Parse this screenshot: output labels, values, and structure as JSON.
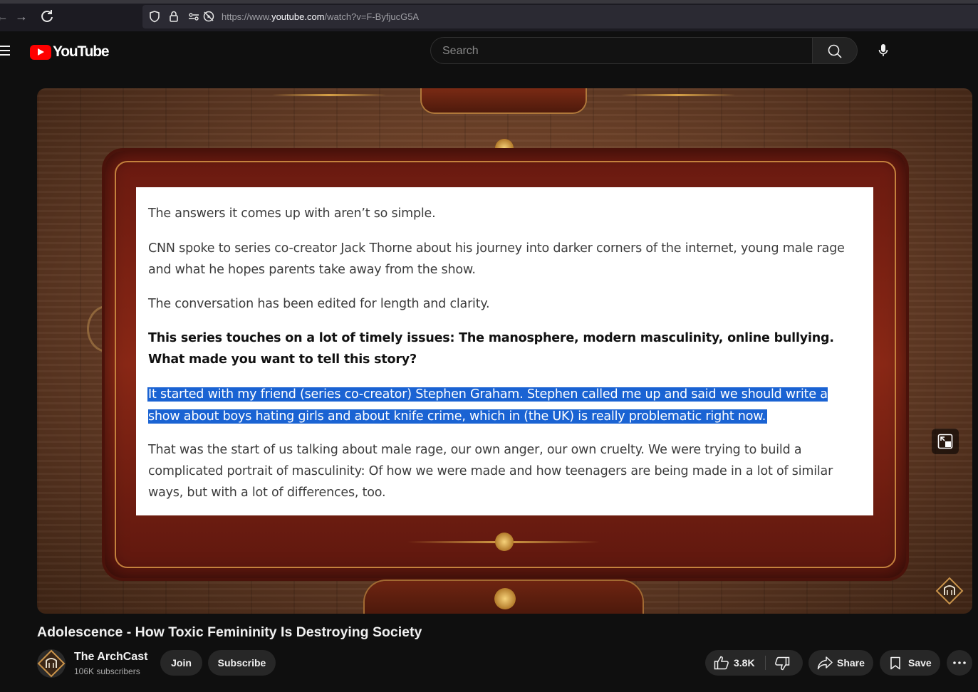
{
  "browser": {
    "url_prefix": "https://www.",
    "url_domain": "youtube.com",
    "url_path": "/watch?v=F-ByfjucG5A"
  },
  "header": {
    "logo_text": "YouTube",
    "search_placeholder": "Search"
  },
  "video": {
    "article_paragraphs": [
      "The answers it comes up with aren’t so simple.",
      "CNN spoke to series co-creator Jack Thorne about his journey into darker corners of the internet, young male rage and what he hopes parents take away from the show.",
      "The conversation has been edited for length and clarity.",
      "This series touches on a lot of timely issues: The manosphere, modern masculinity, online bullying. What made you want to tell this story?",
      "It started with my friend (series co-creator) Stephen Graham. Stephen called me up and said we should write a show about boys hating girls and about knife crime, which in (the UK) is really problematic right now.",
      "That was the start of us talking about male rage, our own anger, our own cruelty. We were trying to build a complicated portrait of masculinity: Of how we were made and how teenagers are being made in a lot of similar ways, but with a lot of differences, too."
    ],
    "highlight_color": "#1a63d3"
  },
  "meta": {
    "title": "Adolescence - How Toxic Femininity Is Destroying Society",
    "channel_name": "The ArchCast",
    "subscribers": "106K subscribers",
    "join_label": "Join",
    "subscribe_label": "Subscribe",
    "like_count": "3.8K",
    "share_label": "Share",
    "save_label": "Save"
  },
  "colors": {
    "background": "#0f0f0f",
    "pill": "#272727",
    "brand_red": "#ff0000"
  }
}
